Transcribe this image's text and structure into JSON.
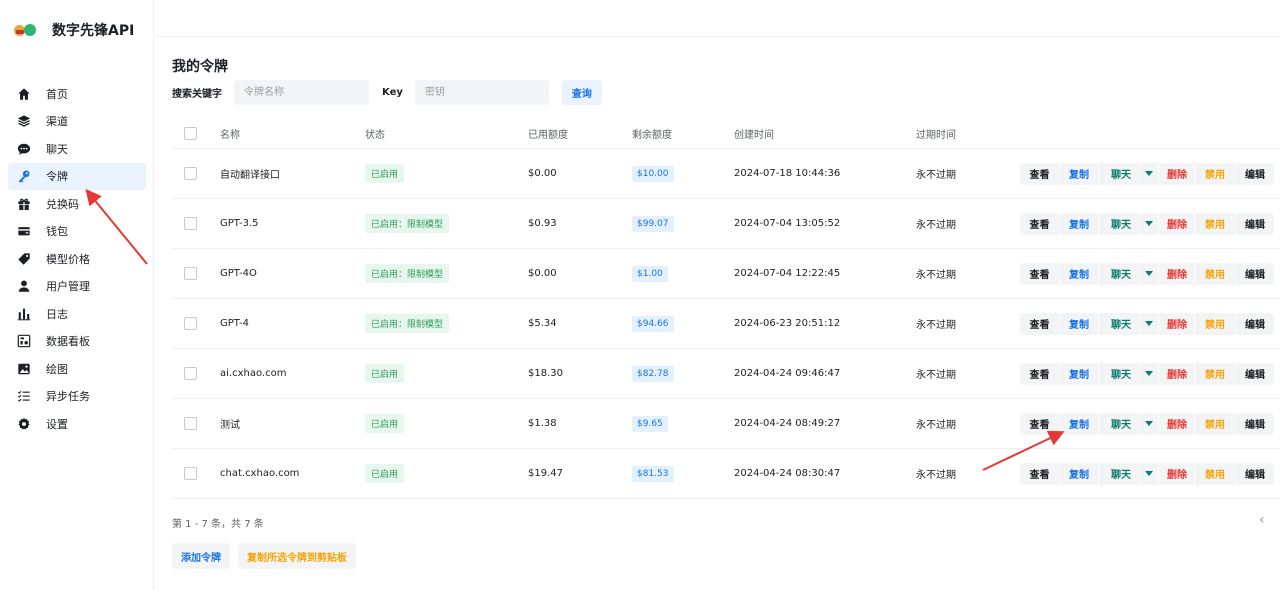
{
  "brand": {
    "name": "数字先锋API"
  },
  "sidebar": {
    "items": [
      {
        "label": "首页",
        "icon": "home-icon"
      },
      {
        "label": "渠道",
        "icon": "layers-icon"
      },
      {
        "label": "聊天",
        "icon": "chat-icon"
      },
      {
        "label": "令牌",
        "icon": "key-icon",
        "active": true
      },
      {
        "label": "兑换码",
        "icon": "gift-icon"
      },
      {
        "label": "钱包",
        "icon": "wallet-icon"
      },
      {
        "label": "模型价格",
        "icon": "tag-icon"
      },
      {
        "label": "用户管理",
        "icon": "user-icon"
      },
      {
        "label": "日志",
        "icon": "bar-chart-icon"
      },
      {
        "label": "数据看板",
        "icon": "dashboard-icon"
      },
      {
        "label": "绘图",
        "icon": "image-icon"
      },
      {
        "label": "异步任务",
        "icon": "task-list-icon"
      },
      {
        "label": "设置",
        "icon": "gear-icon"
      }
    ]
  },
  "page": {
    "title": "我的令牌"
  },
  "search": {
    "keyword_label": "搜索关键字",
    "keyword_placeholder": "令牌名称",
    "key_label": "Key",
    "key_placeholder": "密钥",
    "query_label": "查询"
  },
  "table": {
    "headers": {
      "name": "名称",
      "status": "状态",
      "used": "已用额度",
      "remain": "剩余额度",
      "created": "创建时间",
      "expire": "过期时间"
    },
    "actions": {
      "view": "查看",
      "copy": "复制",
      "chat": "聊天",
      "delete": "删除",
      "disable": "禁用",
      "edit": "编辑"
    },
    "rows": [
      {
        "name": "自动翻译接口",
        "status": "已启用",
        "used": "$0.00",
        "remain": "$10.00",
        "created": "2024-07-18 10:44:36",
        "expire": "永不过期"
      },
      {
        "name": "GPT-3.5",
        "status": "已启用：限制模型",
        "used": "$0.93",
        "remain": "$99.07",
        "created": "2024-07-04 13:05:52",
        "expire": "永不过期"
      },
      {
        "name": "GPT-4O",
        "status": "已启用：限制模型",
        "used": "$0.00",
        "remain": "$1.00",
        "created": "2024-07-04 12:22:45",
        "expire": "永不过期"
      },
      {
        "name": "GPT-4",
        "status": "已启用：限制模型",
        "used": "$5.34",
        "remain": "$94.66",
        "created": "2024-06-23 20:51:12",
        "expire": "永不过期"
      },
      {
        "name": "ai.cxhao.com",
        "status": "已启用",
        "used": "$18.30",
        "remain": "$82.78",
        "created": "2024-04-24 09:46:47",
        "expire": "永不过期"
      },
      {
        "name": "测试",
        "status": "已启用",
        "used": "$1.38",
        "remain": "$9.65",
        "created": "2024-04-24 08:49:27",
        "expire": "永不过期"
      },
      {
        "name": "chat.cxhao.com",
        "status": "已启用",
        "used": "$19.47",
        "remain": "$81.53",
        "created": "2024-04-24 08:30:47",
        "expire": "永不过期"
      }
    ]
  },
  "pager": {
    "text": "第 1 - 7 条，共 7 条",
    "prev_icon": "chevron-left-icon"
  },
  "footer": {
    "add_label": "添加令牌",
    "copy_selected_label": "复制所选令牌到剪贴板"
  },
  "colors": {
    "accent": "#1a73e8",
    "success": "#2d9c57",
    "danger": "#e53935",
    "warning": "#f5a30a",
    "annotation": "#e53935"
  }
}
